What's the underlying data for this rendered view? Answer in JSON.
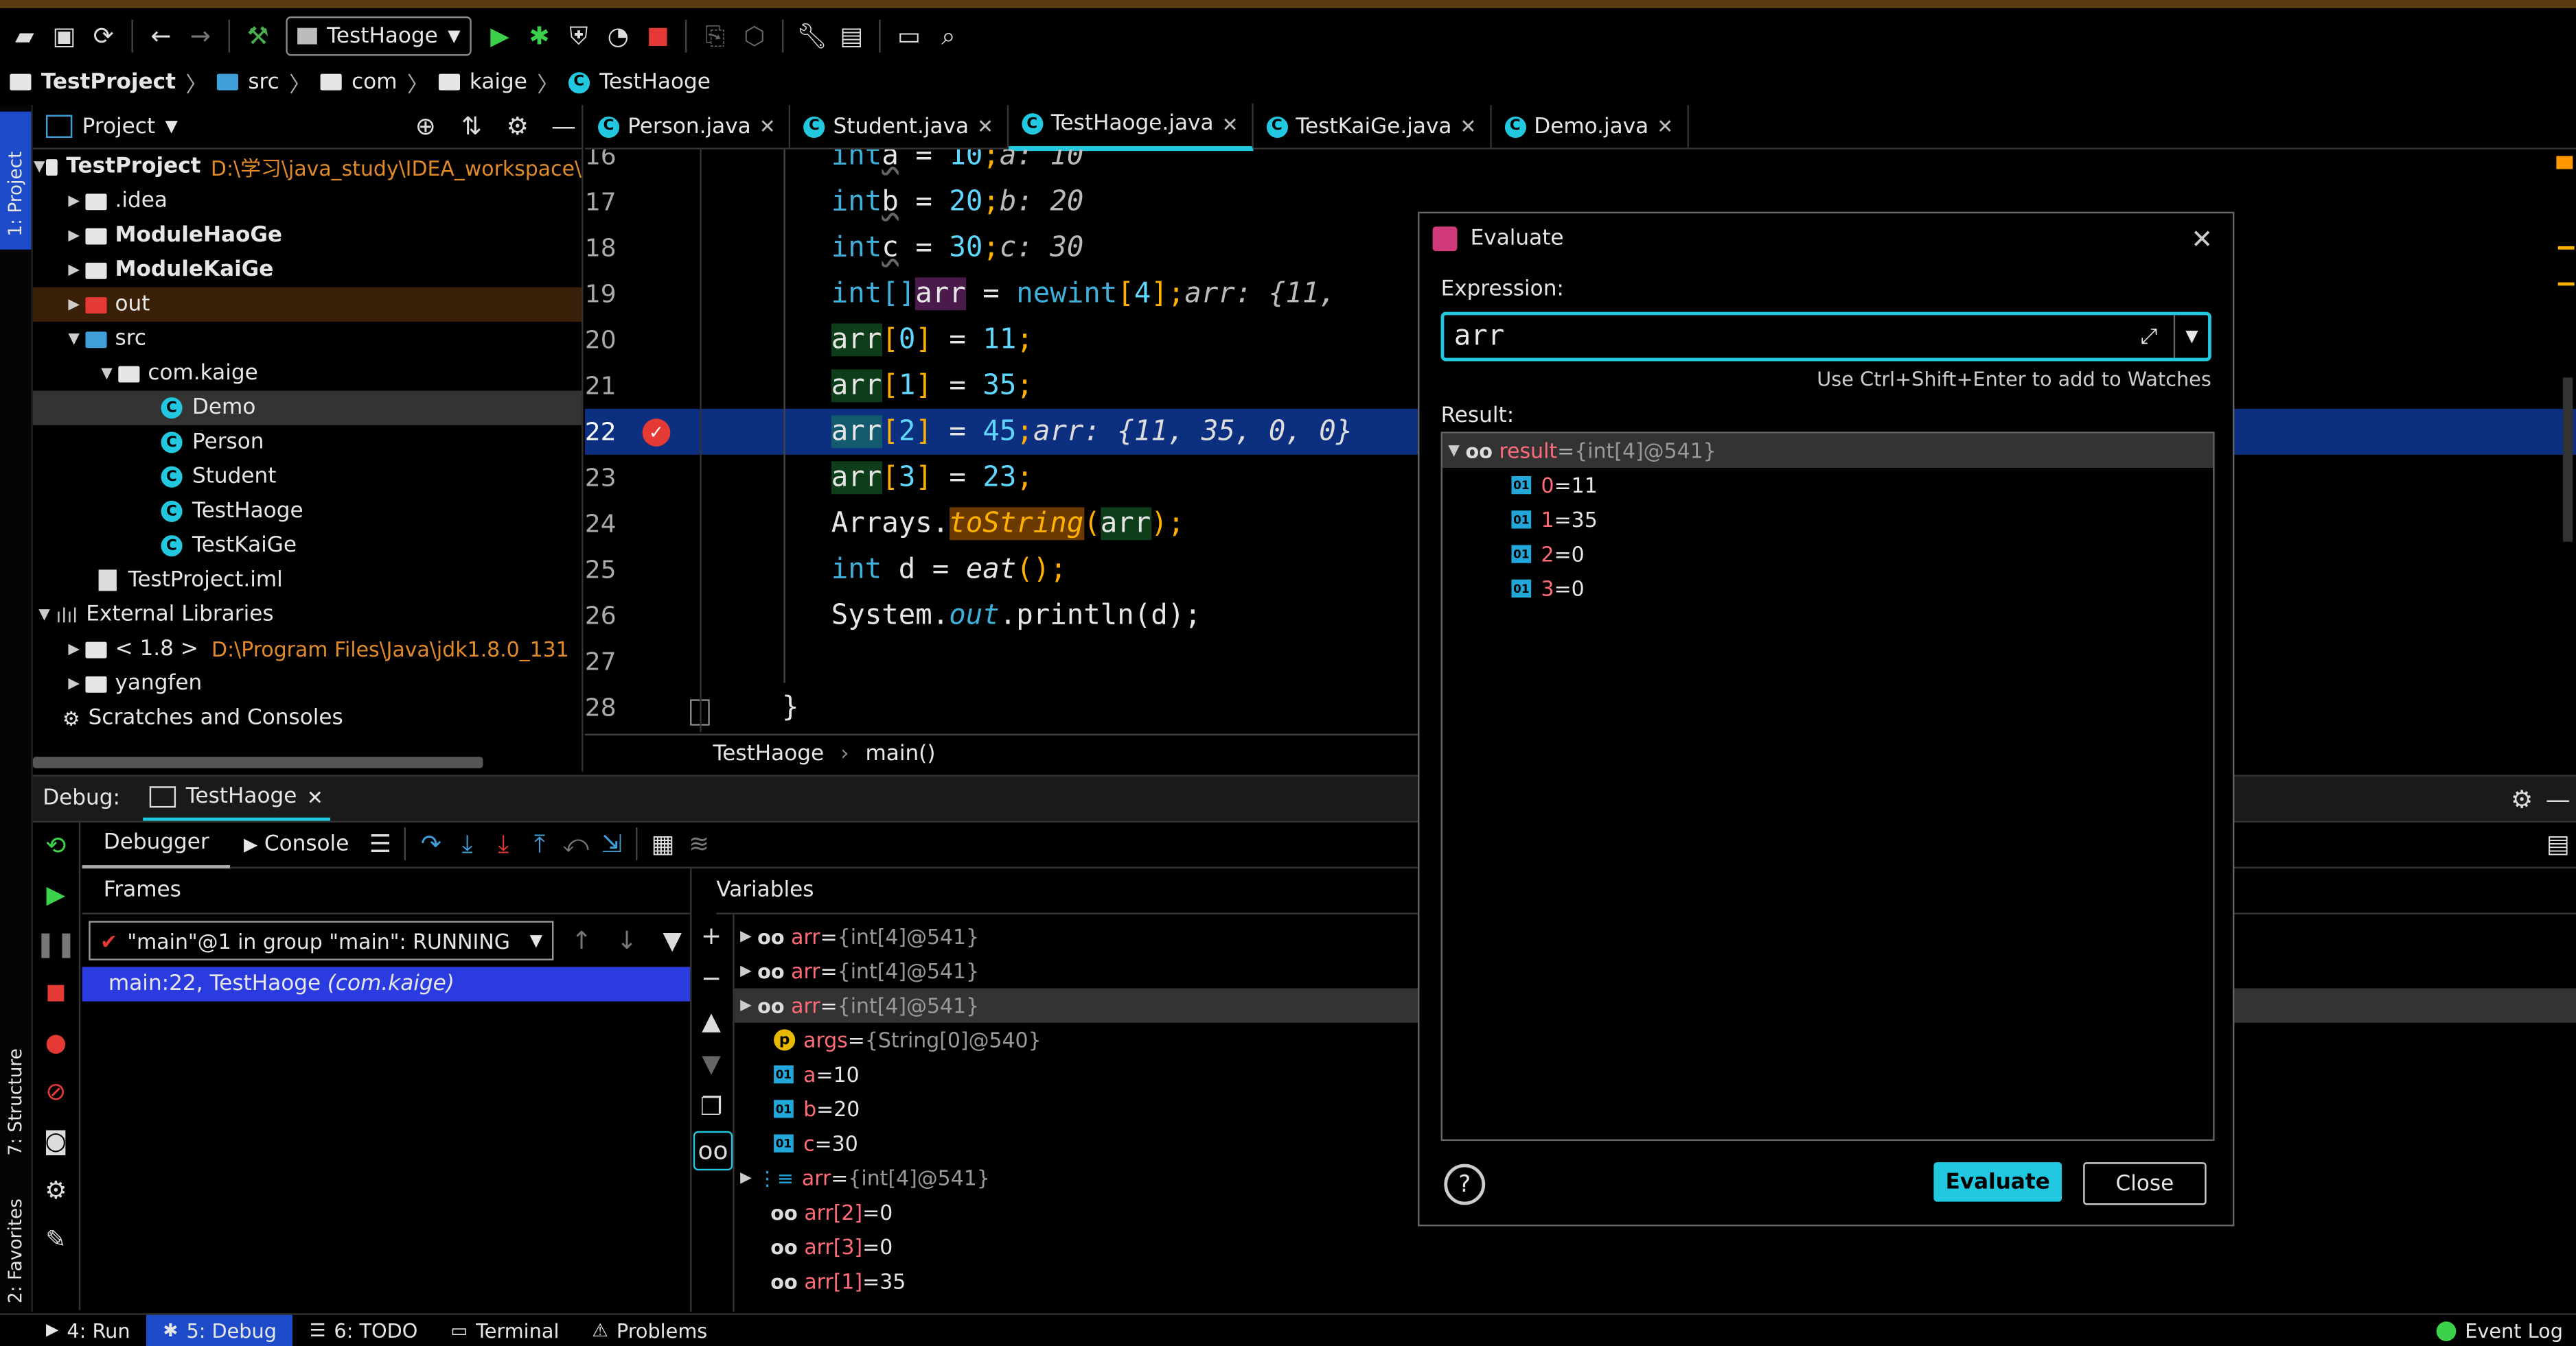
{
  "toolbar": {
    "run_config": "TestHaoge"
  },
  "breadcrumb": [
    "TestProject",
    "src",
    "com",
    "kaige",
    "TestHaoge"
  ],
  "project_panel": {
    "header": "Project",
    "tree": [
      {
        "label": "TestProject",
        "path": "D:\\学习\\java_study\\IDEA_workspace\\",
        "bold": true
      },
      {
        "label": ".idea"
      },
      {
        "label": "ModuleHaoGe",
        "bold": true
      },
      {
        "label": "ModuleKaiGe",
        "bold": true
      },
      {
        "label": "out"
      },
      {
        "label": "src"
      },
      {
        "label": "com.kaige"
      },
      {
        "label": "Demo"
      },
      {
        "label": "Person"
      },
      {
        "label": "Student"
      },
      {
        "label": "TestHaoge"
      },
      {
        "label": "TestKaiGe"
      },
      {
        "label": "TestProject.iml"
      },
      {
        "label": "External Libraries"
      },
      {
        "label": "< 1.8 >",
        "path": "D:\\Program Files\\Java\\jdk1.8.0_131"
      },
      {
        "label": "yangfen"
      },
      {
        "label": "Scratches and Consoles"
      }
    ]
  },
  "side_tabs": {
    "project": "1: Project",
    "structure": "7: Structure",
    "favorites": "2: Favorites"
  },
  "editor": {
    "tabs": [
      "Person.java",
      "Student.java",
      "TestHaoge.java",
      "TestKaiGe.java",
      "Demo.java"
    ],
    "active_tab": "TestHaoge.java",
    "line_numbers": [
      "16",
      "17",
      "18",
      "19",
      "20",
      "21",
      "22",
      "23",
      "24",
      "25",
      "26",
      "27",
      "28"
    ],
    "lines": {
      "l16": {
        "kw": "int",
        "name": "a",
        "rest": " = ",
        "val": "10",
        "end": ";",
        "hint": "a: 10"
      },
      "l17": {
        "kw": "int",
        "name": "b",
        "rest": " = ",
        "val": "20",
        "end": ";",
        "hint": "b: 20"
      },
      "l18": {
        "kw": "int",
        "name": "c",
        "rest": " = ",
        "val": "30",
        "end": ";",
        "hint": "c: 30"
      },
      "l19": {
        "kw": "int[]",
        "name": "arr",
        "rest": " = ",
        "new": "new",
        "type": "int",
        "open": "[",
        "size": "4",
        "close": "];",
        "hint": "arr: {11,"
      },
      "l20": {
        "name": "arr",
        "open": "[",
        "idx": "0",
        "close": "]",
        "rest": " = ",
        "val": "11",
        "end": ";"
      },
      "l21": {
        "name": "arr",
        "open": "[",
        "idx": "1",
        "close": "]",
        "rest": " = ",
        "val": "35",
        "end": ";"
      },
      "l22": {
        "name": "arr",
        "open": "[",
        "idx": "2",
        "close": "]",
        "rest": " = ",
        "val": "45",
        "end": ";",
        "hint": "arr: {11, 35, 0, 0}"
      },
      "l23": {
        "name": "arr",
        "open": "[",
        "idx": "3",
        "close": "]",
        "rest": " = ",
        "val": "23",
        "end": ";"
      },
      "l24": {
        "pre": "Arrays.",
        "method": "toString",
        "open": "(",
        "arg": "arr",
        "end": ");"
      },
      "l25": {
        "kw": "int",
        "rest": " d = ",
        "method": "eat",
        "end": "();"
      },
      "l26": {
        "pre": "System.",
        "field": "out",
        "rest": ".println(d);"
      },
      "l28": {
        "text": "}"
      }
    },
    "crumbs": [
      "TestHaoge",
      "main()"
    ]
  },
  "debug": {
    "label": "Debug:",
    "session": "TestHaoge",
    "tabs": {
      "debugger": "Debugger",
      "console": "Console"
    },
    "frames_header": "Frames",
    "thread": "\"main\"@1 in group \"main\": RUNNING",
    "frame_loc": "main:22, TestHaoge",
    "frame_pkg": "(com.kaige)",
    "variables_header": "Variables",
    "variables": [
      {
        "name": "arr",
        "eq": " = ",
        "value": "{int[4]@541}"
      },
      {
        "name": "arr",
        "eq": " = ",
        "value": "{int[4]@541}"
      },
      {
        "name": "arr",
        "eq": " = ",
        "value": "{int[4]@541}"
      },
      {
        "name": "args",
        "eq": " = ",
        "value": "{String[0]@540}"
      },
      {
        "name": "a",
        "eq": " = ",
        "value": "10"
      },
      {
        "name": "b",
        "eq": " = ",
        "value": "20"
      },
      {
        "name": "c",
        "eq": " = ",
        "value": "30"
      },
      {
        "name": "arr",
        "eq": " = ",
        "value": "{int[4]@541}"
      },
      {
        "name": "arr[2]",
        "eq": " = ",
        "value": "0"
      },
      {
        "name": "arr[3]",
        "eq": " = ",
        "value": "0"
      },
      {
        "name": "arr[1]",
        "eq": " = ",
        "value": "35"
      }
    ]
  },
  "evaluate": {
    "title": "Evaluate",
    "expression_label": "Expression:",
    "expression": "arr",
    "hint": "Use Ctrl+Shift+Enter to add to Watches",
    "result_label": "Result:",
    "result_root": {
      "name": "result",
      "eq": " = ",
      "value": "{int[4]@541}"
    },
    "items": [
      {
        "name": "0",
        "eq": " = ",
        "value": "11"
      },
      {
        "name": "1",
        "eq": " = ",
        "value": "35"
      },
      {
        "name": "2",
        "eq": " = ",
        "value": "0"
      },
      {
        "name": "3",
        "eq": " = ",
        "value": "0"
      }
    ],
    "evaluate_button": "Evaluate",
    "close_button": "Close",
    "help": "?"
  },
  "statusbar": {
    "run": "4: Run",
    "debug": "5: Debug",
    "todo": "6: TODO",
    "terminal": "Terminal",
    "problems": "Problems",
    "event_log": "Event Log"
  },
  "colors": {
    "accent": "#22c7e0",
    "selection": "#0d2f80",
    "frame_selection": "#2a3ce0",
    "keyword": "#3fb0d9",
    "var_name": "#ff6b78",
    "path_orange": "#e08a2a"
  }
}
